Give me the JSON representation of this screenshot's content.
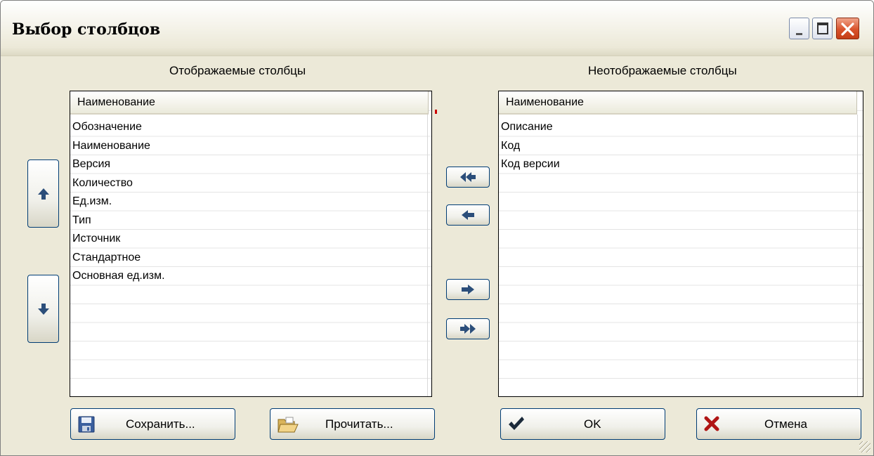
{
  "window": {
    "title": "Выбор столбцов"
  },
  "left_panel": {
    "caption": "Отображаемые столбцы",
    "column_header": "Наименование",
    "items": [
      "Обозначение",
      "Наименование",
      "Версия",
      "Количество",
      "Ед.изм.",
      "Тип",
      "Источник",
      "Стандартное",
      "Основная ед.изм."
    ]
  },
  "right_panel": {
    "caption": "Неотображаемые столбцы",
    "column_header": "Наименование",
    "items": [
      "Описание",
      "Код",
      "Код версии"
    ]
  },
  "buttons": {
    "save": "Сохранить...",
    "load": "Прочитать...",
    "ok": "OK",
    "cancel": "Отмена"
  },
  "icons": {
    "up": "arrow-up-icon",
    "down": "arrow-down-icon",
    "all_left": "double-arrow-left-icon",
    "left": "arrow-left-icon",
    "right": "arrow-right-icon",
    "all_right": "double-arrow-right-icon",
    "save": "floppy-disk-icon",
    "load": "open-folder-icon",
    "ok": "checkmark-icon",
    "cancel": "red-x-icon"
  },
  "colors": {
    "window_bg": "#ECE9D8",
    "button_border": "#003C74",
    "close_button": "#D9532C",
    "arrow": "#2B4E7A"
  }
}
